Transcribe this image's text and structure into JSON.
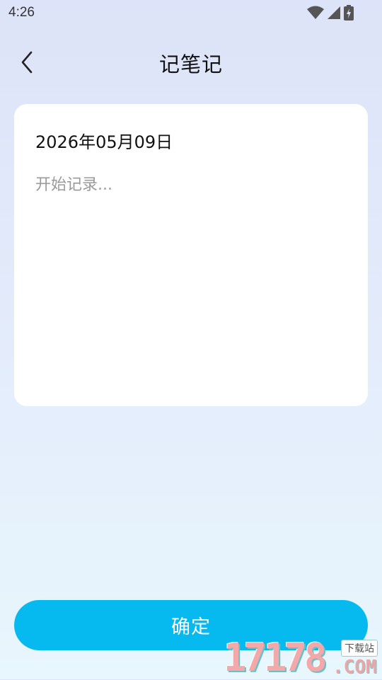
{
  "status_bar": {
    "time": "4:26",
    "icons": [
      "wifi-icon",
      "cell-signal-icon",
      "battery-charging-icon"
    ]
  },
  "header": {
    "back_icon": "chevron-left-icon",
    "title": "记笔记"
  },
  "note": {
    "date": "2026年05月09日",
    "content_value": "",
    "content_placeholder": "开始记录..."
  },
  "actions": {
    "confirm_label": "确定"
  },
  "watermark": {
    "digits": "17178",
    "suffix": ".COM",
    "tag": "下载站"
  },
  "colors": {
    "accent": "#06baf0",
    "background_top": "#dde3f8",
    "background_bottom": "#e8f6fd",
    "card": "#ffffff",
    "placeholder": "#9a9a9a"
  }
}
